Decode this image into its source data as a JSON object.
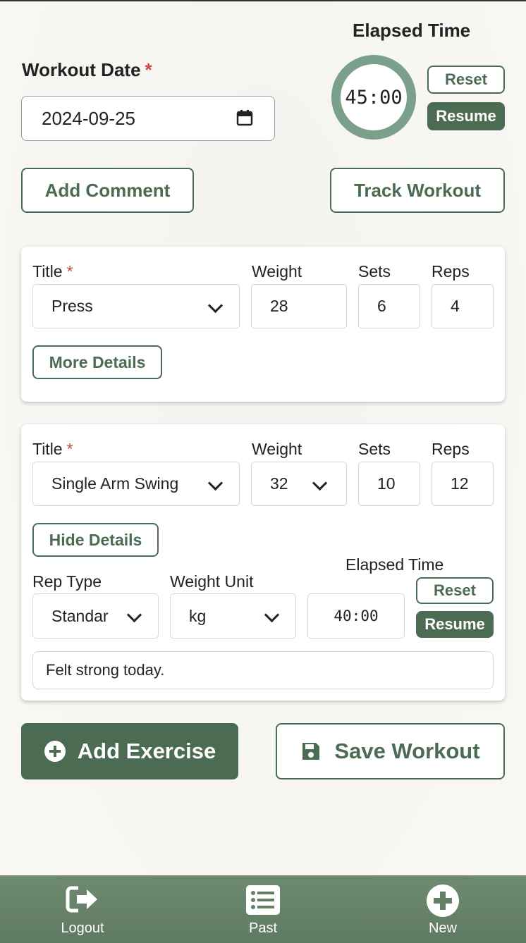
{
  "header": {
    "workout_date_label": "Workout Date",
    "required_mark": "*",
    "workout_date_value": "2024-09-25",
    "elapsed_time_label": "Elapsed Time",
    "timer_value": "45:00",
    "reset_label": "Reset",
    "resume_label": "Resume",
    "add_comment_label": "Add Comment",
    "track_workout_label": "Track Workout"
  },
  "columns": {
    "title": "Title",
    "weight": "Weight",
    "sets": "Sets",
    "reps": "Reps"
  },
  "exercises": [
    {
      "title": "Press",
      "weight": "28",
      "sets": "6",
      "reps": "4",
      "details_button": "More Details"
    },
    {
      "title": "Single Arm Swing",
      "weight": "32",
      "sets": "10",
      "reps": "12",
      "details_button": "Hide Details",
      "details": {
        "rep_type_label": "Rep Type",
        "rep_type_value": "Standar",
        "weight_unit_label": "Weight Unit",
        "weight_unit_value": "kg",
        "elapsed_time_label": "Elapsed Time",
        "timer_value": "40:00",
        "reset_label": "Reset",
        "resume_label": "Resume",
        "comment_value": "Felt strong today."
      }
    }
  ],
  "actions": {
    "add_exercise_label": "Add Exercise",
    "save_workout_label": "Save Workout"
  },
  "nav": {
    "logout": "Logout",
    "past": "Past",
    "new": "New"
  },
  "colors": {
    "accent": "#4b6b53",
    "timer_ring": "#7a9f8a",
    "nav_bg": "#647f66",
    "required": "#cc4444"
  }
}
